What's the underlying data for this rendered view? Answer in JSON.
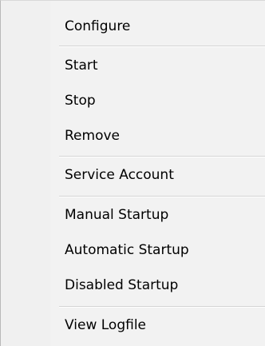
{
  "context_menu": {
    "items": [
      {
        "label": "Configure"
      },
      {
        "label": "Start"
      },
      {
        "label": "Stop"
      },
      {
        "label": "Remove"
      },
      {
        "label": "Service Account"
      },
      {
        "label": "Manual Startup"
      },
      {
        "label": "Automatic Startup"
      },
      {
        "label": "Disabled Startup"
      },
      {
        "label": "View Logfile"
      }
    ]
  }
}
